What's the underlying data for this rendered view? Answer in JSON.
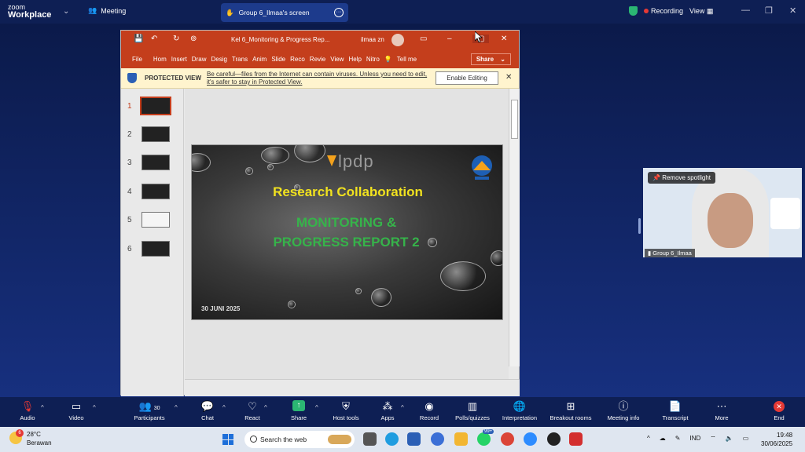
{
  "zoom": {
    "logo_line1": "zoom",
    "logo_line2": "Workplace",
    "meeting_label": "Meeting",
    "screen_tab": "Group 6_Ilmaa's screen",
    "recording": "Recording",
    "view": "View"
  },
  "ppt": {
    "title": "Kel 6_Monitoring & Progress Rep...",
    "user": "ilmaa zn",
    "tabs": [
      "File",
      "Hom",
      "Insert",
      "Draw",
      "Desig",
      "Trans",
      "Anim",
      "Slide",
      "Reco",
      "Revie",
      "View",
      "Help",
      "Nitro",
      "Tell me"
    ],
    "share": "Share",
    "protected_label": "PROTECTED VIEW",
    "protected_msg": "Be careful—files from the Internet can contain viruses. Unless you need to edit, it's safer to stay in Protected View.",
    "enable_editing": "Enable Editing",
    "thumb_numbers": [
      "1",
      "2",
      "3",
      "4",
      "5",
      "6"
    ]
  },
  "slide": {
    "logo_text": "lpdp",
    "heading": "Research Collaboration",
    "subtitle_line1": "MONITORING &",
    "subtitle_line2": "PROGRESS REPORT 2",
    "date": "30 JUNI 2025"
  },
  "video": {
    "remove_spotlight": "Remove spotlight",
    "participant_name": "Group 6_Ilmaa"
  },
  "toolbar": {
    "audio": "Audio",
    "video": "Video",
    "participants": "Participants",
    "participant_count": "30",
    "chat": "Chat",
    "react": "React",
    "share": "Share",
    "host_tools": "Host tools",
    "apps": "Apps",
    "record": "Record",
    "polls": "Polls/quizzes",
    "interpretation": "Interpretation",
    "breakout": "Breakout rooms",
    "meeting_info": "Meeting info",
    "transcript": "Transcript",
    "more": "More",
    "end": "End"
  },
  "taskbar": {
    "temperature": "28°C",
    "weather": "Berawan",
    "weather_badge": "6",
    "search": "Search the web",
    "language": "IND",
    "time": "19:48",
    "date": "30/06/2025",
    "badge": "99+"
  }
}
